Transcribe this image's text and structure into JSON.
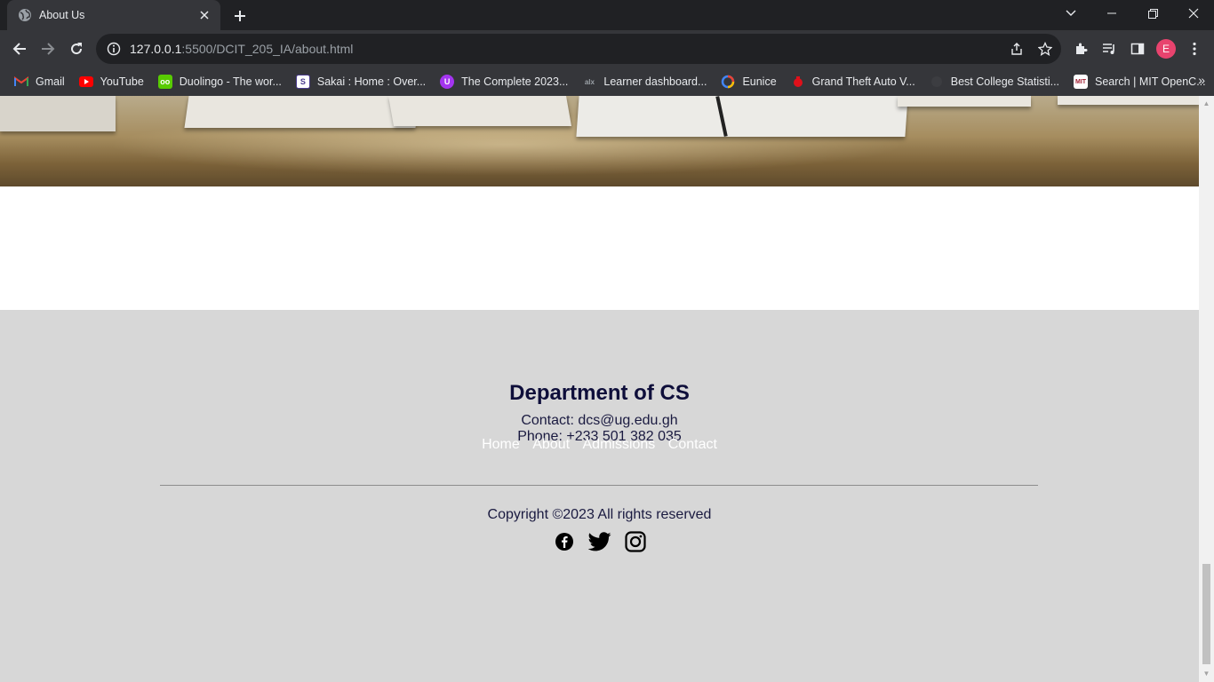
{
  "tab": {
    "title": "About Us"
  },
  "address": {
    "host": "127.0.0.1",
    "path": ":5500/DCIT_205_IA/about.html"
  },
  "profile": {
    "initial": "E",
    "color": "#e8436e"
  },
  "bookmarks": [
    {
      "label": "Gmail",
      "icon": "gmail-icon"
    },
    {
      "label": "YouTube",
      "icon": "youtube-icon"
    },
    {
      "label": "Duolingo - The wor...",
      "icon": "duolingo-icon"
    },
    {
      "label": "Sakai : Home : Over...",
      "icon": "sakai-icon"
    },
    {
      "label": "The Complete 2023...",
      "icon": "udemy-icon"
    },
    {
      "label": "Learner dashboard...",
      "icon": "alx-icon"
    },
    {
      "label": "Eunice",
      "icon": "eunice-icon"
    },
    {
      "label": "Grand Theft Auto V...",
      "icon": "gta-icon"
    },
    {
      "label": "Best College Statisti...",
      "icon": "blank-site-icon"
    },
    {
      "label": "Search | MIT OpenC...",
      "icon": "mit-ocw-icon"
    }
  ],
  "footer": {
    "department": "Department of CS",
    "contact": "Contact: dcs@ug.edu.gh",
    "phone": "Phone: +233 501 382 035",
    "links": [
      "Home",
      "About",
      "Admissions",
      "Contact"
    ],
    "copyright": "Copyright ©2023 All rights reserved",
    "socials": [
      "facebook-icon",
      "twitter-icon",
      "instagram-icon"
    ]
  },
  "colors": {
    "footer_bg": "#d7d7d7",
    "heading": "#0e0e3a",
    "link": "#ffffff"
  }
}
